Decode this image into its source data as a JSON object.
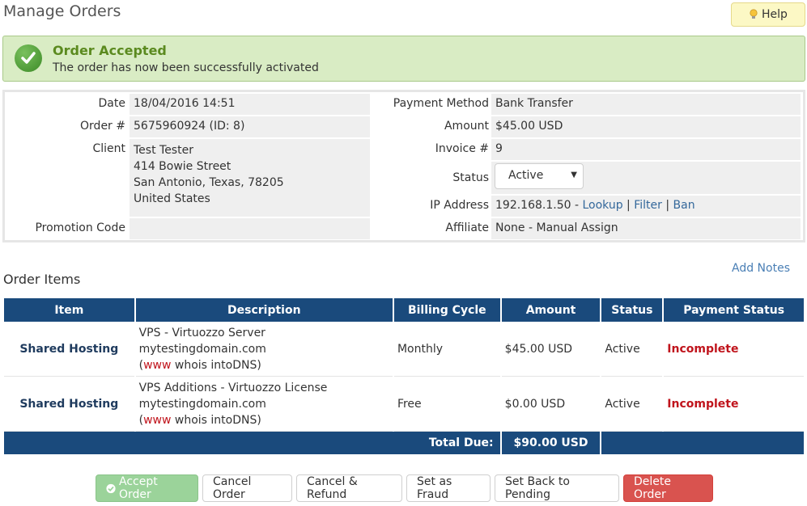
{
  "page": {
    "title": "Manage Orders",
    "help_label": "Help"
  },
  "alert": {
    "title": "Order Accepted",
    "message": "The order has now been successfully activated"
  },
  "order": {
    "date_label": "Date",
    "date": "18/04/2016 14:51",
    "order_label": "Order #",
    "order_number": "5675960924 (ID: 8)",
    "client_label": "Client",
    "client_lines": [
      "Test Tester",
      "414 Bowie Street",
      "San Antonio, Texas, 78205",
      "United States"
    ],
    "promo_label": "Promotion Code",
    "promo": "",
    "payment_method_label": "Payment Method",
    "payment_method": "Bank Transfer",
    "amount_label": "Amount",
    "amount": "$45.00 USD",
    "invoice_label": "Invoice #",
    "invoice": "9",
    "status_label": "Status",
    "status": "Active",
    "ip_label": "IP Address",
    "ip": "192.168.1.50",
    "ip_sep": " - ",
    "ip_lookup": "Lookup",
    "ip_filter": "Filter",
    "ip_ban": "Ban",
    "pipe": " | ",
    "affiliate_label": "Affiliate",
    "affiliate": "None",
    "affiliate_sep": " - ",
    "affiliate_assign": "Manual Assign"
  },
  "items_section": {
    "title": "Order Items",
    "add_notes": "Add Notes"
  },
  "table": {
    "headers": [
      "Item",
      "Description",
      "Billing Cycle",
      "Amount",
      "Status",
      "Payment Status"
    ],
    "rows": [
      {
        "item": "Shared Hosting",
        "desc_title": "VPS - Virtuozzo Server",
        "domain": "mytestingdomain.com",
        "open_paren": "(",
        "www": "www",
        "whois": "whois",
        "intodns": "intoDNS",
        "close_paren": ")",
        "billing": "Monthly",
        "amount": "$45.00 USD",
        "status": "Active",
        "payment_status": "Incomplete"
      },
      {
        "item": "Shared Hosting",
        "desc_title": "VPS Additions - Virtuozzo License",
        "domain": "mytestingdomain.com",
        "open_paren": "(",
        "www": "www",
        "whois": "whois",
        "intodns": "intoDNS",
        "close_paren": ")",
        "billing": "Free",
        "amount": "$0.00 USD",
        "status": "Active",
        "payment_status": "Incomplete"
      }
    ],
    "total_label": "Total Due:",
    "total": "$90.00 USD"
  },
  "actions": {
    "accept": "Accept Order",
    "cancel": "Cancel Order",
    "cancel_refund": "Cancel & Refund",
    "fraud": "Set as Fraud",
    "pending": "Set Back to Pending",
    "delete": "Delete Order"
  },
  "colors": {
    "header_blue": "#1a4a7c",
    "success_bg": "#d9ecc4",
    "incomplete_red": "#c0141c",
    "accept_green": "#9bd39a",
    "delete_red": "#d9534f"
  }
}
